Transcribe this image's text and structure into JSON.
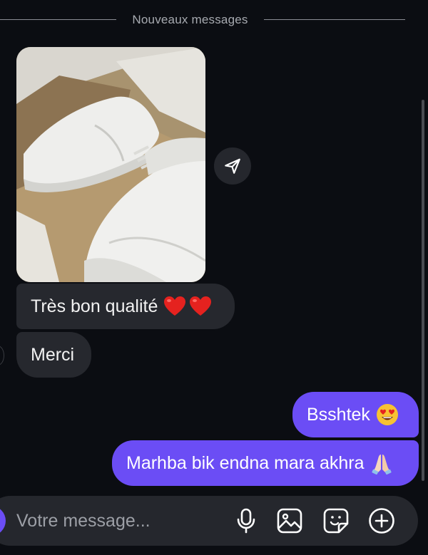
{
  "divider": {
    "label": "Nouveaux messages"
  },
  "messages": {
    "incoming_1": {
      "text": "Très bon qualité"
    },
    "incoming_2": {
      "text": "Merci"
    },
    "outgoing_1": {
      "text": "Bsshtek"
    },
    "outgoing_2": {
      "text": "Marhba bik endna mara akhra"
    }
  },
  "composer": {
    "placeholder": "Votre message..."
  },
  "icons": {
    "share": "paper-plane-icon",
    "mic": "microphone-icon",
    "gallery": "image-icon",
    "sticker": "sticker-icon",
    "plus": "plus-circle-icon"
  },
  "colors": {
    "background": "#0b0d12",
    "incoming_bubble": "#26282e",
    "outgoing_bubble": "#6b4df5",
    "composer": "#25272d"
  }
}
